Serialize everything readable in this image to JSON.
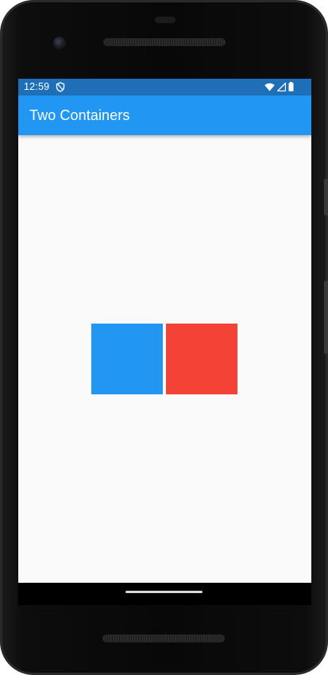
{
  "status_bar": {
    "time": "12:59",
    "icons": [
      "shield-icon",
      "wifi-icon",
      "signal-icon",
      "battery-icon"
    ]
  },
  "app_bar": {
    "title": "Two Containers"
  },
  "containers": [
    {
      "color": "#2196f3"
    },
    {
      "color": "#f44336"
    }
  ],
  "colors": {
    "status_bar": "#1e6fb8",
    "app_bar": "#2196f3",
    "background": "#fafafa"
  }
}
